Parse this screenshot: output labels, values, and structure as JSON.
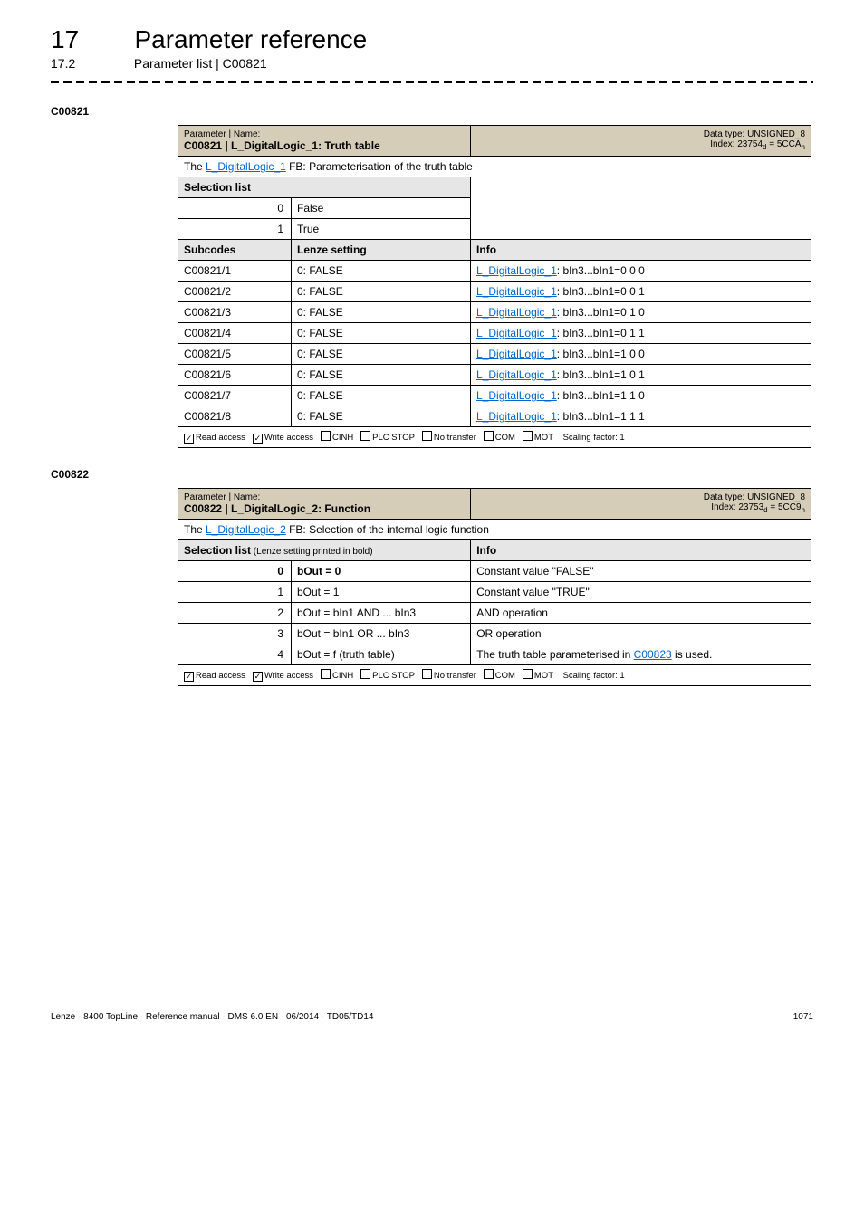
{
  "header": {
    "chapter_num": "17",
    "chapter_title": "Parameter reference",
    "section_num": "17.2",
    "section_title": "Parameter list | C00821"
  },
  "p821": {
    "id": "C00821",
    "hdr_left_top": "Parameter | Name:",
    "hdr_left_name": "C00821 | L_DigitalLogic_1: Truth table",
    "dtype1": "Data type: UNSIGNED_8",
    "dtype2_prefix": "Index: 23754",
    "dtype2_sub1": "d",
    "dtype2_mid": " = 5CCA",
    "dtype2_sub2": "h",
    "desc_prefix": "The ",
    "desc_link": "L_DigitalLogic_1",
    "desc_suffix": " FB: Parameterisation of the truth table",
    "sel_label": "Selection list",
    "sel0_n": "0",
    "sel0_v": "False",
    "sel1_n": "1",
    "sel1_v": "True",
    "col1": "Subcodes",
    "col2": "Lenze setting",
    "col3": "Info",
    "rows": [
      {
        "sc": "C00821/1",
        "ls": "0: FALSE",
        "link": "L_DigitalLogic_1",
        "suffix": ": bIn3...bIn1=0 0 0"
      },
      {
        "sc": "C00821/2",
        "ls": "0: FALSE",
        "link": "L_DigitalLogic_1",
        "suffix": ": bIn3...bIn1=0 0 1"
      },
      {
        "sc": "C00821/3",
        "ls": "0: FALSE",
        "link": "L_DigitalLogic_1",
        "suffix": ": bIn3...bIn1=0 1 0"
      },
      {
        "sc": "C00821/4",
        "ls": "0: FALSE",
        "link": "L_DigitalLogic_1",
        "suffix": ": bIn3...bIn1=0 1 1"
      },
      {
        "sc": "C00821/5",
        "ls": "0: FALSE",
        "link": "L_DigitalLogic_1",
        "suffix": ": bIn3...bIn1=1 0 0"
      },
      {
        "sc": "C00821/6",
        "ls": "0: FALSE",
        "link": "L_DigitalLogic_1",
        "suffix": ": bIn3...bIn1=1 0 1"
      },
      {
        "sc": "C00821/7",
        "ls": "0: FALSE",
        "link": "L_DigitalLogic_1",
        "suffix": ": bIn3...bIn1=1 1 0"
      },
      {
        "sc": "C00821/8",
        "ls": "0: FALSE",
        "link": "L_DigitalLogic_1",
        "suffix": ": bIn3...bIn1=1 1 1"
      }
    ]
  },
  "p822": {
    "id": "C00822",
    "hdr_left_top": "Parameter | Name:",
    "hdr_left_name": "C00822 | L_DigitalLogic_2: Function",
    "dtype1": "Data type: UNSIGNED_8",
    "dtype2_prefix": "Index: 23753",
    "dtype2_sub1": "d",
    "dtype2_mid": " = 5CC9",
    "dtype2_sub2": "h",
    "desc_prefix": "The ",
    "desc_link": "L_DigitalLogic_2",
    "desc_suffix": " FB: Selection of the internal logic function",
    "col1": "Selection list",
    "col1_suffix": " (Lenze setting printed in bold)",
    "col2": "Info",
    "rows": [
      {
        "n": "0",
        "v": "bOut = 0",
        "bold": true,
        "info": "Constant value \"FALSE\""
      },
      {
        "n": "1",
        "v": "bOut = 1",
        "bold": false,
        "info": "Constant value \"TRUE\""
      },
      {
        "n": "2",
        "v": "bOut = bIn1 AND ... bIn3",
        "bold": false,
        "info": "AND operation"
      },
      {
        "n": "3",
        "v": "bOut = bIn1 OR ... bIn3",
        "bold": false,
        "info": "OR operation"
      },
      {
        "n": "4",
        "v": "bOut = f (truth table)",
        "bold": false,
        "info_prefix": "The truth table parameterised in ",
        "info_link": "C00823",
        "info_suffix": "  is used."
      }
    ]
  },
  "foot": {
    "read": "Read access",
    "write": "Write access",
    "cinh": "CINH",
    "plc": "PLC STOP",
    "notr": "No transfer",
    "com": "COM",
    "mot": "MOT",
    "scale": "Scaling factor: 1"
  },
  "footer": {
    "left": "Lenze · 8400 TopLine · Reference manual · DMS 6.0 EN · 06/2014 · TD05/TD14",
    "right": "1071"
  }
}
